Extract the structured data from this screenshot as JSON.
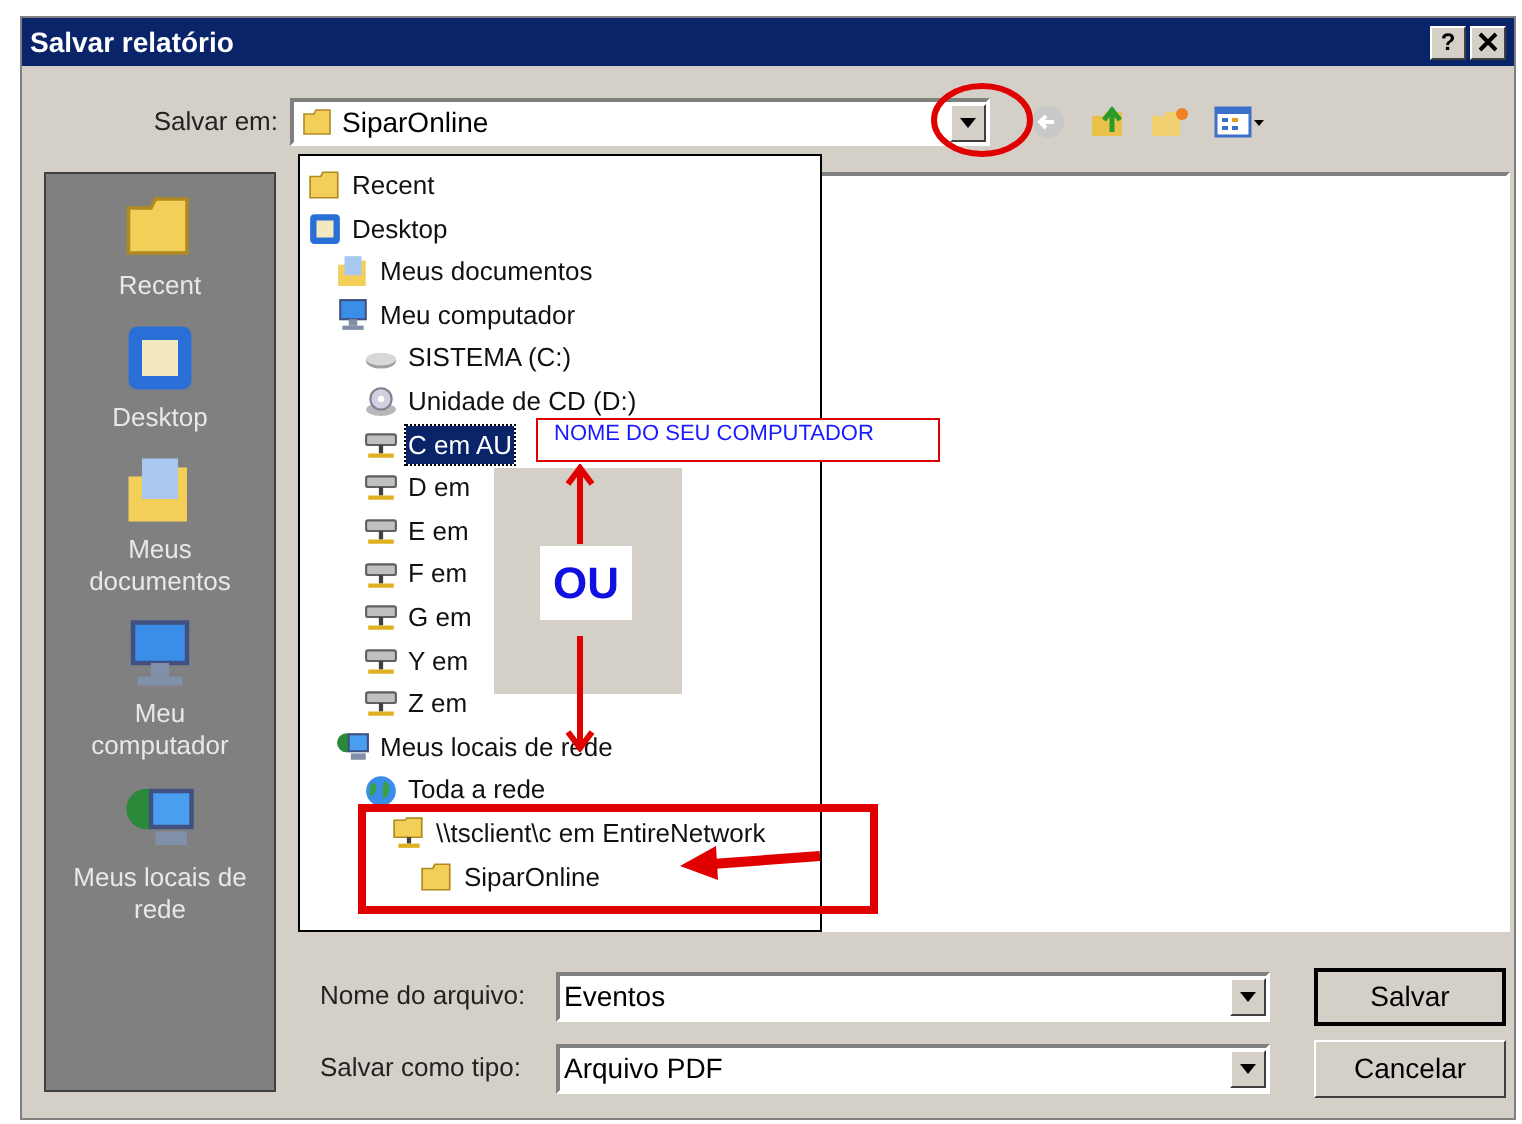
{
  "window": {
    "title": "Salvar relatório",
    "help_button": "?"
  },
  "location": {
    "label": "Salvar em:",
    "value": "SiparOnline",
    "expanded": true,
    "tree": [
      {
        "label": "Recent",
        "kind": "folder",
        "selected": false
      },
      {
        "label": "Desktop",
        "kind": "desktop",
        "selected": false,
        "children": [
          {
            "label": "Meus documentos",
            "kind": "documents",
            "selected": false
          },
          {
            "label": "Meu computador",
            "kind": "computer",
            "selected": false,
            "children": [
              {
                "label": "SISTEMA (C:)",
                "kind": "drive",
                "selected": false
              },
              {
                "label": "Unidade de CD (D:)",
                "kind": "cd",
                "selected": false
              },
              {
                "label": "C em AU",
                "kind": "netdrive",
                "selected": true
              },
              {
                "label": "D em",
                "kind": "netdrive",
                "selected": false
              },
              {
                "label": "E em",
                "kind": "netdrive",
                "selected": false
              },
              {
                "label": "F em",
                "kind": "netdrive",
                "selected": false
              },
              {
                "label": "G em",
                "kind": "netdrive",
                "selected": false
              },
              {
                "label": "Y em",
                "kind": "netdrive",
                "selected": false
              },
              {
                "label": "Z em",
                "kind": "netdrive",
                "selected": false
              }
            ]
          },
          {
            "label": "Meus locais de rede",
            "kind": "network",
            "selected": false,
            "children": [
              {
                "label": "Toda a rede",
                "kind": "globe",
                "selected": false,
                "children": [
                  {
                    "label": "\\\\tsclient\\c em EntireNetwork",
                    "kind": "netfolder",
                    "selected": false,
                    "children": [
                      {
                        "label": "SiparOnline",
                        "kind": "folder",
                        "selected": false
                      }
                    ]
                  }
                ]
              }
            ]
          }
        ]
      }
    ]
  },
  "places": [
    {
      "label": "Recent",
      "kind": "folder"
    },
    {
      "label": "Desktop",
      "kind": "desktop"
    },
    {
      "label": "Meus documentos",
      "kind": "documents"
    },
    {
      "label": "Meu computador",
      "kind": "computer"
    },
    {
      "label": "Meus locais de rede",
      "kind": "network"
    }
  ],
  "file_name": {
    "label": "Nome do arquivo:",
    "value": "Eventos"
  },
  "file_type": {
    "label": "Salvar como tipo:",
    "value": "Arquivo PDF"
  },
  "buttons": [
    {
      "label": "Salvar",
      "default": true
    },
    {
      "label": "Cancelar",
      "default": false
    }
  ],
  "annotations": {
    "callout_label": "NOME DO SEU COMPUTADOR",
    "or_label": "OU"
  }
}
